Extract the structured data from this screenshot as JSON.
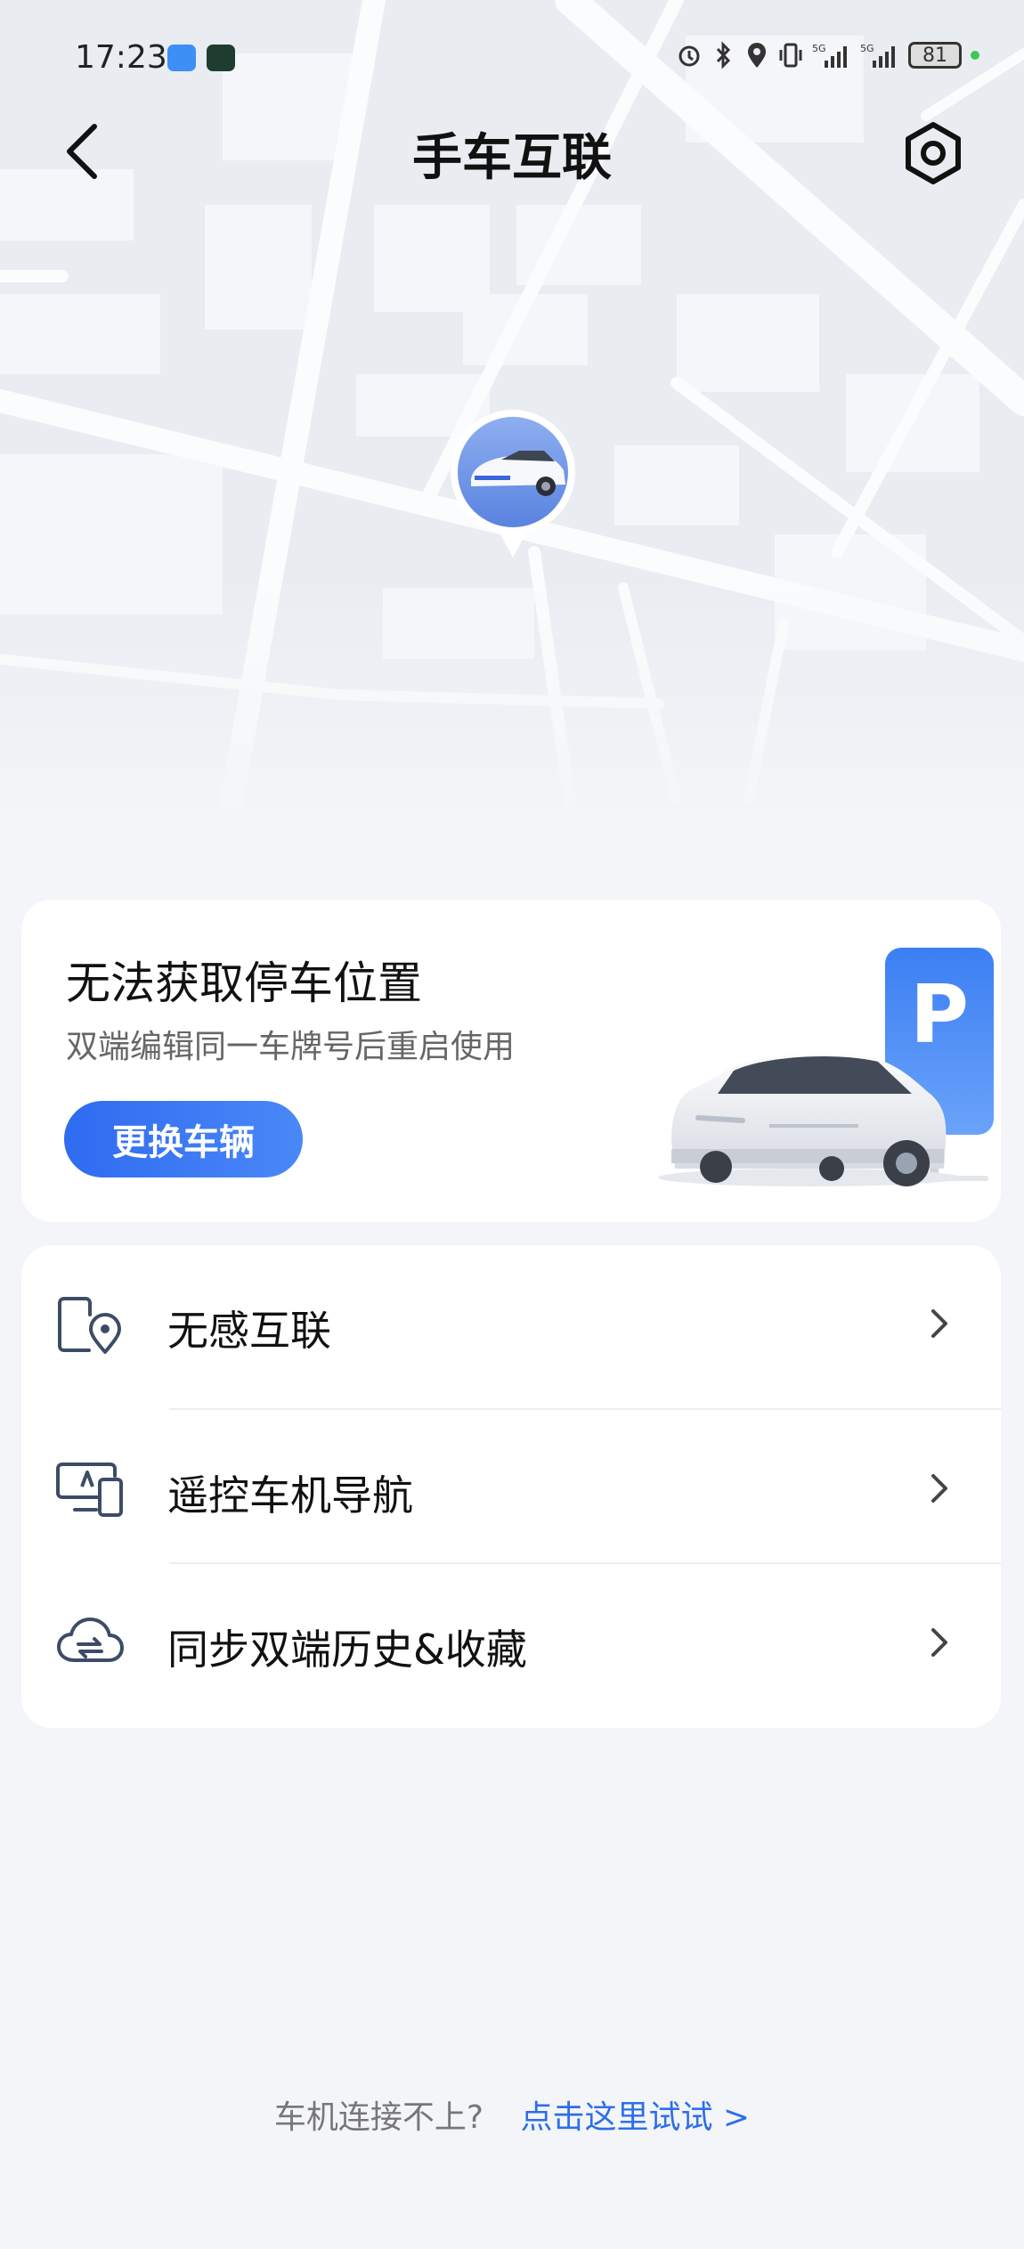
{
  "status_bar": {
    "time": "17:23",
    "battery": "81",
    "icons": [
      "cloud-app-icon",
      "app-icon",
      "alarm-icon",
      "bluetooth-icon",
      "location-icon",
      "vibrate-icon",
      "signal-5g-icon",
      "signal-5g-icon",
      "battery-icon"
    ]
  },
  "header": {
    "title": "手车互联",
    "back_icon": "back-arrow-icon",
    "settings_icon": "settings-hex-icon"
  },
  "parking_card": {
    "title": "无法获取停车位置",
    "subtitle": "双端编辑同一车牌号后重启使用",
    "button_label": "更换车辆",
    "sign_letter": "P"
  },
  "menu": {
    "items": [
      {
        "label": "无感互联",
        "icon": "phone-location-icon"
      },
      {
        "label": "遥控车机导航",
        "icon": "screen-phone-icon"
      },
      {
        "label": "同步双端历史&收藏",
        "icon": "cloud-sync-icon"
      }
    ]
  },
  "footer": {
    "question": "车机连接不上?",
    "link": "点击这里试试 >"
  },
  "colors": {
    "accent": "#2f6bf0",
    "link": "#2e6ee8",
    "background": "#f3f5f8"
  }
}
